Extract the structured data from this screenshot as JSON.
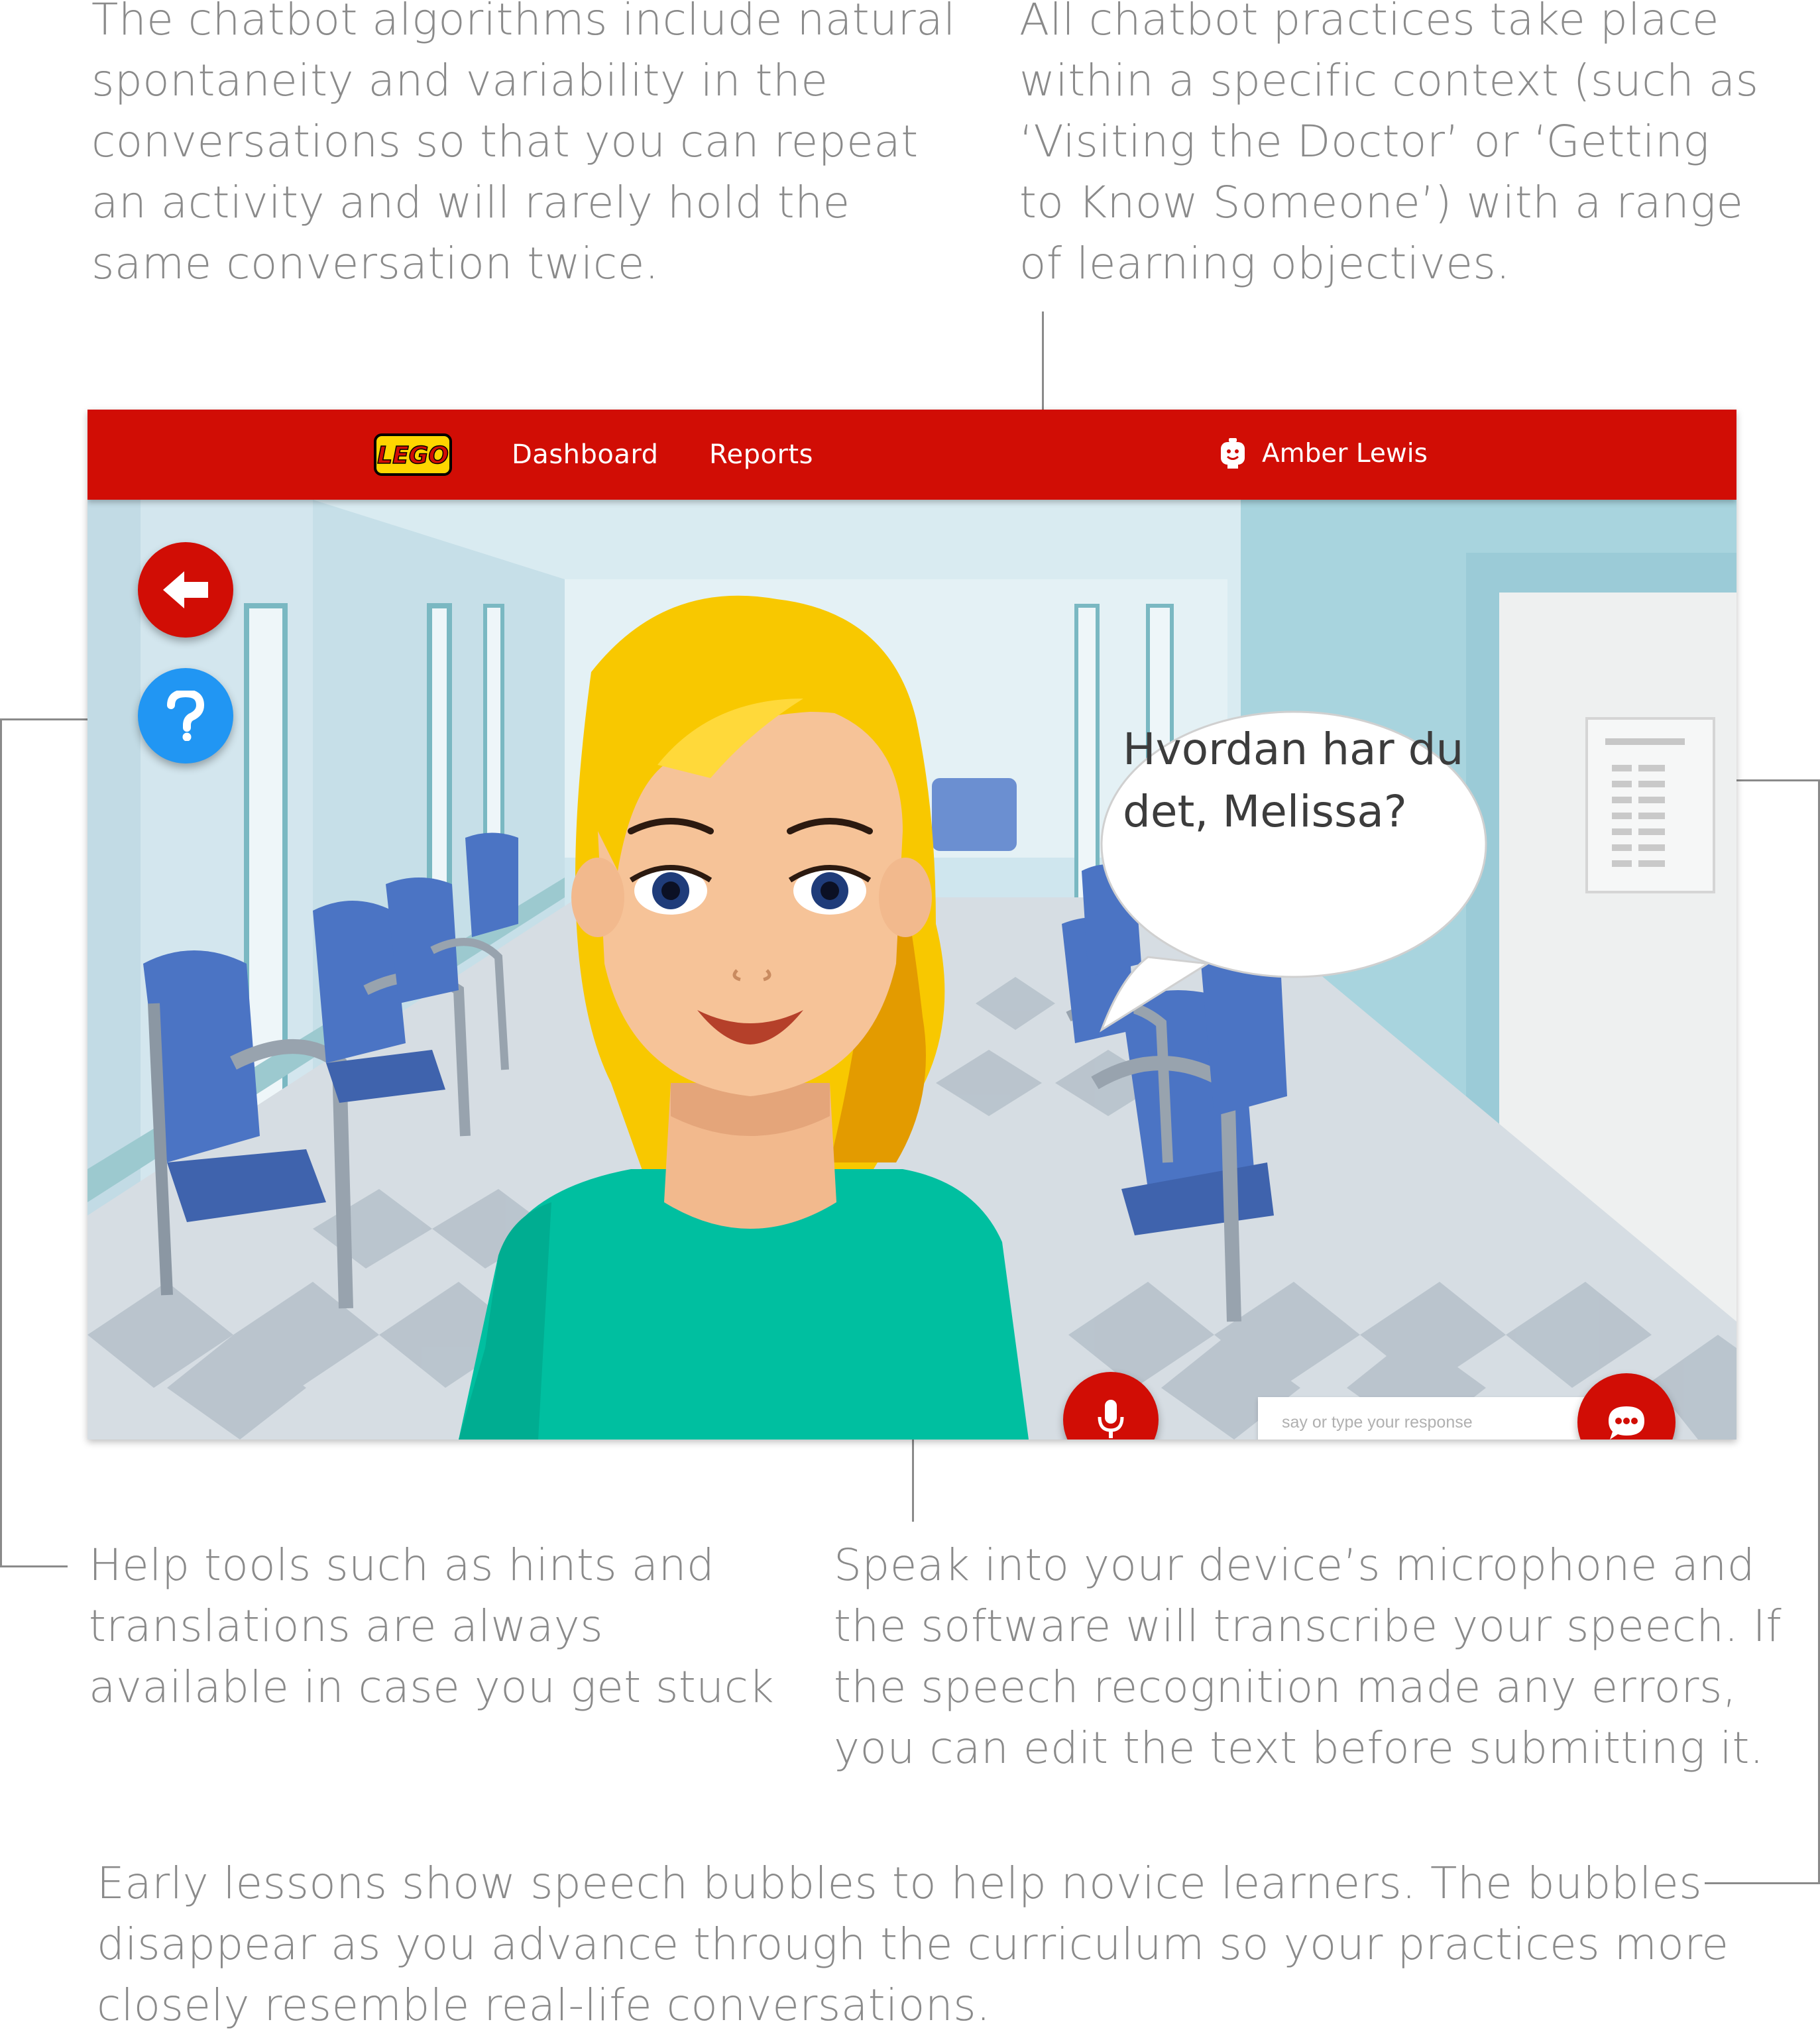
{
  "annotations": {
    "top_left": "The chatbot algorithms include natural\nspontaneity and variability in the\nconversations so that you can repeat\nan activity and will rarely hold the\nsame conversation twice.",
    "top_right": "All chatbot practices take place\nwithin a specific context (such as\n‘Visiting the Doctor’ or ‘Getting\nto Know Someone’) with a range\nof learning objectives.",
    "help_tools": "Help tools such as hints and\ntranslations are always\navailable in case you get stuck",
    "speech": "Speak into your device’s microphone and\nthe software will transcribe your speech. If\nthe speech recognition made any errors,\nyou can edit the text before submitting it.",
    "bubbles": "Early lessons show speech bubbles to help novice learners.  The bubbles\ndisappear as you advance through the curriculum so your practices more\nclosely resemble real-life conversations."
  },
  "navbar": {
    "logo_text": "LEGO",
    "links": [
      "Dashboard",
      "Reports"
    ],
    "user_name": "Amber Lewis"
  },
  "scene": {
    "speech_bubble": "Hvordan har du det, Melissa?",
    "response_placeholder": "say or type your response"
  },
  "icons": {
    "back": "arrow-left-icon",
    "help": "question-mark-icon",
    "mic": "microphone-icon",
    "send": "chat-bubble-icon",
    "user": "user-avatar-icon"
  },
  "colors": {
    "brand_red": "#d10d05",
    "help_blue": "#2196f3",
    "annotation_gray": "#8a8a8a"
  }
}
